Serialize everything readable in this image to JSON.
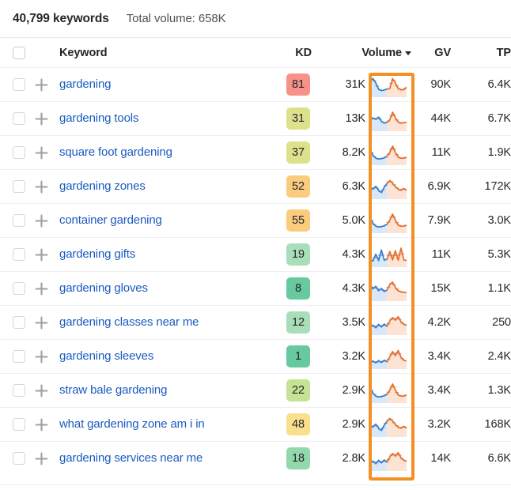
{
  "summary": {
    "keyword_count": "40,799 keywords",
    "total_volume": "Total volume: 658K"
  },
  "table": {
    "columns": {
      "select_all": "select-all-checkbox",
      "keyword": "Keyword",
      "kd": "KD",
      "volume": "Volume",
      "volume_sort": "descending",
      "gv": "GV",
      "tp": "TP"
    },
    "rows": [
      {
        "keyword": "gardening",
        "kd": "81",
        "kd_color": "#F79189",
        "volume": "31K",
        "gv": "90K",
        "tp": "6.4K",
        "spark": "peak-double"
      },
      {
        "keyword": "gardening tools",
        "kd": "31",
        "kd_color": "#DEE18C",
        "volume": "13K",
        "gv": "44K",
        "tp": "6.7K",
        "spark": "wavy-peak"
      },
      {
        "keyword": "square foot gardening",
        "kd": "37",
        "kd_color": "#DEE18C",
        "volume": "8.2K",
        "gv": "11K",
        "tp": "1.9K",
        "spark": "dip-peak"
      },
      {
        "keyword": "gardening zones",
        "kd": "52",
        "kd_color": "#FBCB7E",
        "volume": "6.3K",
        "gv": "6.9K",
        "tp": "172K",
        "spark": "zigzag"
      },
      {
        "keyword": "container gardening",
        "kd": "55",
        "kd_color": "#FBCB7E",
        "volume": "5.0K",
        "gv": "7.9K",
        "tp": "3.0K",
        "spark": "dip-peak"
      },
      {
        "keyword": "gardening gifts",
        "kd": "19",
        "kd_color": "#A8DFB8",
        "volume": "4.3K",
        "gv": "11K",
        "tp": "5.3K",
        "spark": "spiky"
      },
      {
        "keyword": "gardening gloves",
        "kd": "8",
        "kd_color": "#68C99E",
        "volume": "4.3K",
        "gv": "15K",
        "tp": "1.1K",
        "spark": "noisy-peak"
      },
      {
        "keyword": "gardening classes near me",
        "kd": "12",
        "kd_color": "#A8DFB8",
        "volume": "3.5K",
        "gv": "4.2K",
        "tp": "250",
        "spark": "noisy-rise"
      },
      {
        "keyword": "gardening sleeves",
        "kd": "1",
        "kd_color": "#68C99E",
        "volume": "3.2K",
        "gv": "3.4K",
        "tp": "2.4K",
        "spark": "flat-rise"
      },
      {
        "keyword": "straw bale gardening",
        "kd": "22",
        "kd_color": "#C6E294",
        "volume": "2.9K",
        "gv": "3.4K",
        "tp": "1.3K",
        "spark": "dip-peak"
      },
      {
        "keyword": "what gardening zone am i in",
        "kd": "48",
        "kd_color": "#FAE08C",
        "volume": "2.9K",
        "gv": "3.2K",
        "tp": "168K",
        "spark": "zigzag"
      },
      {
        "keyword": "gardening services near me",
        "kd": "18",
        "kd_color": "#93D8AC",
        "volume": "2.8K",
        "gv": "14K",
        "tp": "6.6K",
        "spark": "noisy-rise"
      }
    ]
  },
  "highlight": {
    "label": "volume-trend-column-highlight",
    "color": "#F29023"
  },
  "sparkline_colors": {
    "past": "#2F7ED8",
    "past_fill": "#D9E8F8",
    "forecast": "#F06A1E",
    "forecast_fill": "#FCE3D4",
    "trend": "#9AA0A6"
  }
}
